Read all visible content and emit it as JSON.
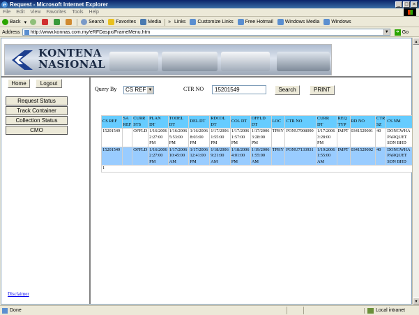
{
  "window": {
    "title": "Request - Microsoft Internet Explorer"
  },
  "menu": [
    "File",
    "Edit",
    "View",
    "Favorites",
    "Tools",
    "Help"
  ],
  "toolbar": {
    "back": "Back",
    "search": "Search",
    "favorites": "Favorites",
    "media": "Media",
    "links": "Links",
    "link_items": [
      "Customize Links",
      "Free Hotmail",
      "Windows Media",
      "Windows"
    ]
  },
  "address": {
    "label": "Address",
    "url": "http://www.konnas.com.my/eRFDaspx/FrameMenu.htm",
    "go": "Go"
  },
  "banner": {
    "logo_text": "KONTENA\nNASIONAL"
  },
  "nav": {
    "home": "Home",
    "logout": "Logout",
    "items": [
      "Request Status",
      "Track Container",
      "Collection Status",
      "CMO"
    ],
    "disclaimer": "Disclaimer"
  },
  "query": {
    "query_by_label": "Query By",
    "query_by_value": "CS REF",
    "ctr_no_label": "CTR NO",
    "ctr_no_value": "15201549",
    "search_button": "Search",
    "print_button": "PRINT"
  },
  "table": {
    "headers": [
      "CS REF",
      "SA REF",
      "CURR STS",
      "PLAN DT",
      "TODEL DT",
      "DEL DT",
      "RDCOL DT",
      "COL DT",
      "OFFLD DT",
      "LOC",
      "CTR NO",
      "CURR DT",
      "REQ TYP",
      "RD NO",
      "CTR SZ",
      "CS NM"
    ],
    "rows": [
      [
        "15201549",
        "",
        "OFFLD",
        "1/16/2006 2:27:00 PM",
        "1/16/2006 5:53:00 PM",
        "1/16/2006 8:03:00 PM",
        "1/17/2006 1:55:00 PM",
        "1/17/2006 1:57:00 PM",
        "1/17/2006 3:28:00 PM",
        "TPHY",
        "PONU7908090",
        "1/17/2006 3:28:00 PM",
        "IMPT",
        "0341529001",
        "40",
        "DONGWHA PARQUET SDN BHD"
      ],
      [
        "15201549",
        "",
        "OFFLD",
        "1/16/2006 2:27:00 PM",
        "1/17/2006 10:45:00 AM",
        "1/17/2006 12:41:00 PM",
        "1/18/2006 9:21:00 AM",
        "1/18/2006 4:01:00 PM",
        "1/19/2006 1:55:00 AM",
        "TPHY",
        "PONU7133931",
        "1/19/2006 1:55:00 AM",
        "IMPT",
        "0341529002",
        "40",
        "DONGWHA PARQUET SDN BHD"
      ]
    ],
    "pager": "1"
  },
  "status": {
    "left": "Done",
    "zone": "Local intranet"
  }
}
